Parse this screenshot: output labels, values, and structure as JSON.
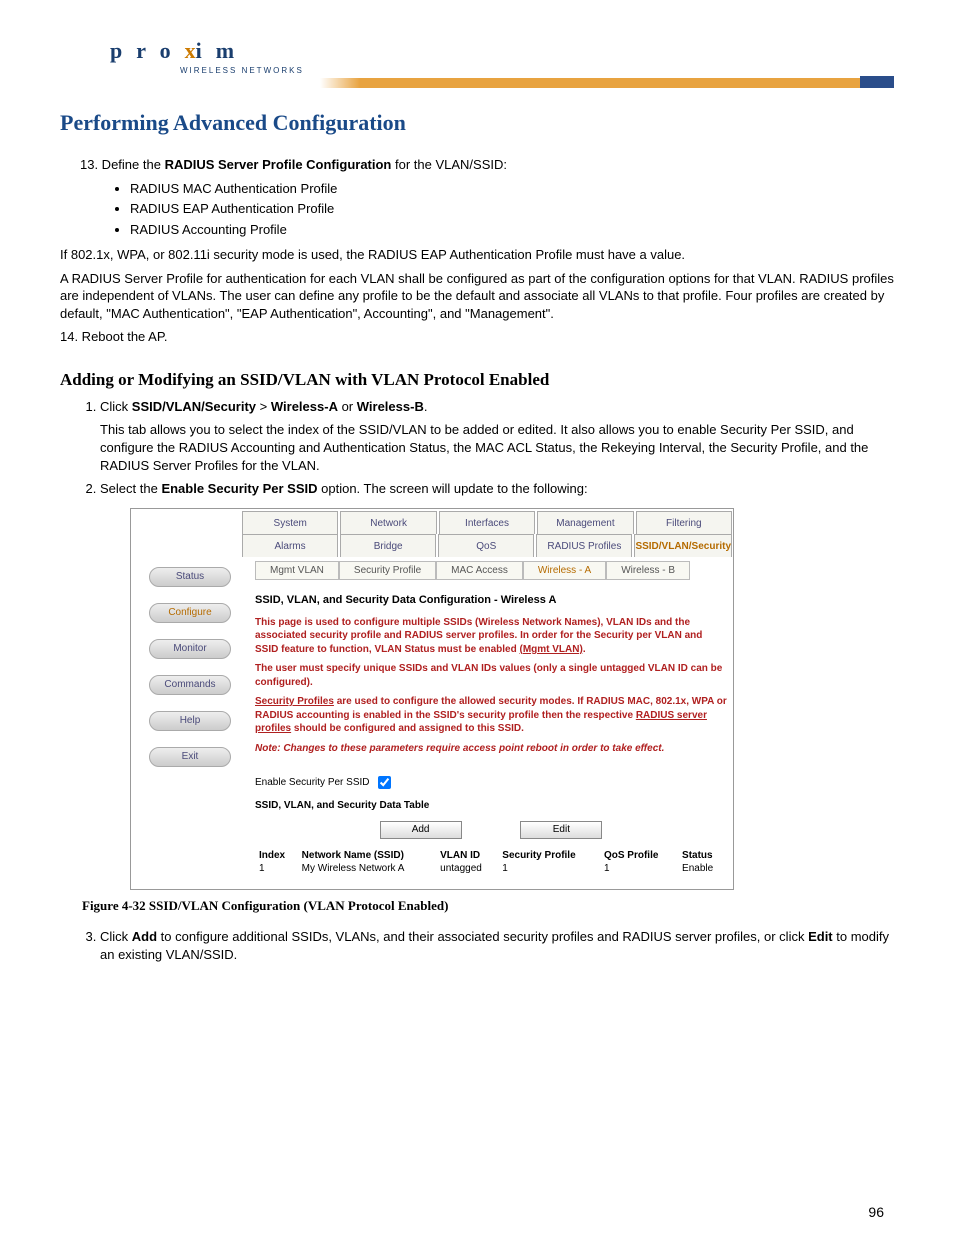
{
  "header": {
    "logo_main": "pro",
    "logo_x": "x",
    "logo_end": "im",
    "logo_sub": "WIRELESS NETWORKS"
  },
  "title": "Performing Advanced Configuration",
  "step13": {
    "prefix": "13. Define the ",
    "bold": "RADIUS Server Profile Configuration",
    "suffix": " for the VLAN/SSID:"
  },
  "bullets": [
    "RADIUS MAC Authentication Profile",
    "RADIUS EAP Authentication Profile",
    "RADIUS Accounting Profile"
  ],
  "para_if": "If 802.1x, WPA, or 802.11i security mode is used, the RADIUS EAP Authentication Profile must have a value.",
  "para_radius": "A RADIUS Server Profile for authentication for each VLAN shall be configured as part of the configuration options for that VLAN. RADIUS profiles are independent of VLANs. The user can define any profile to be the default and associate all VLANs to that profile. Four profiles are created by default, \"MAC Authentication\", \"EAP Authentication\", Accounting\", and \"Management\".",
  "step14": "14. Reboot the AP.",
  "subheading": "Adding or Modifying an SSID/VLAN with VLAN Protocol Enabled",
  "step1": {
    "prefix": "Click ",
    "b1": "SSID/VLAN/Security",
    "sep1": " > ",
    "b2": "Wireless-A",
    "sep2": " or ",
    "b3": "Wireless-B",
    "suffix": "."
  },
  "step1_desc": "This tab allows you to select the index of the SSID/VLAN to be added or edited. It also allows you to enable Security Per SSID, and configure the RADIUS Accounting and Authentication Status, the MAC ACL Status, the Rekeying Interval, the Security Profile, and the RADIUS Server Profiles for the VLAN.",
  "step2": {
    "prefix": "Select the ",
    "bold": "Enable Security Per SSID",
    "suffix": " option. The screen will update to the following:"
  },
  "figure": {
    "tabs1": [
      "System",
      "Network",
      "Interfaces",
      "Management",
      "Filtering"
    ],
    "tabs2": [
      "Alarms",
      "Bridge",
      "QoS",
      "RADIUS Profiles",
      "SSID/VLAN/Security"
    ],
    "tabs2_active": 4,
    "side": [
      "Status",
      "Configure",
      "Monitor",
      "Commands",
      "Help",
      "Exit"
    ],
    "side_active": 1,
    "subtabs": [
      "Mgmt VLAN",
      "Security Profile",
      "MAC Access",
      "Wireless - A",
      "Wireless - B"
    ],
    "subtabs_active": 3,
    "content_title": "SSID, VLAN, and Security Data Configuration - Wireless A",
    "desc1_a": "This page is used to configure multiple SSIDs (Wireless Network Names), VLAN IDs and the associated security profile and RADIUS server profiles. In order for the Security per VLAN and SSID feature to function, VLAN Status must be enabled ",
    "desc1_link": "(Mgmt VLAN)",
    "desc1_b": ".",
    "desc2": "The user must specify unique SSIDs and VLAN IDs values (only a single untagged VLAN ID can be configured).",
    "desc3_link1": "Security Profiles",
    "desc3_mid": " are used to configure the allowed security modes. If RADIUS MAC, 802.1x, WPA or RADIUS accounting is enabled in the SSID's security profile then the respective ",
    "desc3_link2": "RADIUS server profiles",
    "desc3_end": " should be configured and assigned to this SSID.",
    "note": "Note: Changes to these parameters require access point reboot in order to take effect.",
    "enable_label": "Enable Security Per SSID",
    "table_title": "SSID, VLAN, and Security Data Table",
    "btn_add": "Add",
    "btn_edit": "Edit",
    "cols": [
      "Index",
      "Network Name (SSID)",
      "VLAN ID",
      "Security Profile",
      "QoS Profile",
      "Status"
    ],
    "row": [
      "1",
      "My Wireless Network A",
      "untagged",
      "1",
      "1",
      "Enable"
    ]
  },
  "caption_prefix": "Figure 4-32   ",
  "caption_text": "SSID/VLAN Configuration (VLAN Protocol Enabled)",
  "step3": {
    "prefix": "Click ",
    "b1": "Add",
    "mid": " to configure additional SSIDs, VLANs, and their associated security profiles and RADIUS server profiles, or click ",
    "b2": "Edit",
    "suffix": " to modify an existing VLAN/SSID."
  },
  "page_number": "96"
}
